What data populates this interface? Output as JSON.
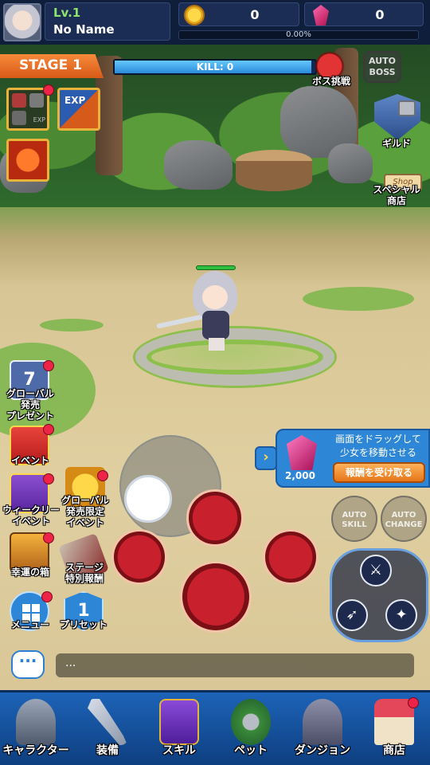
{
  "player": {
    "level": "Lv.1",
    "name": "No Name"
  },
  "currency": {
    "gold": "0",
    "gems": "0",
    "exp_percent": "0.00%"
  },
  "stage": {
    "label": "STAGE 1",
    "kill_text": "KILL: 0",
    "kill_progress": 0.0
  },
  "top_right": {
    "boss_challenge": "ボス挑戦",
    "auto_boss": "AUTO\nBOSS",
    "guild": "ギルド",
    "shop_sign": "Shop",
    "special_shop": "スペシャル\n商店"
  },
  "buffs": {
    "exp_label": "EXP",
    "stat_labels": [
      "EXP"
    ]
  },
  "left_menu": [
    {
      "id": "global-release-present",
      "label": "グローバル\n発売\nプレゼント",
      "badge": "7",
      "has_dot": true
    },
    {
      "id": "event",
      "label": "イベント",
      "has_dot": true
    },
    {
      "id": "weekly-event",
      "label": "ウィークリー\nイベント",
      "has_dot": true
    },
    {
      "id": "global-limited-event",
      "label": "グローバル\n発売限定\nイベント",
      "has_dot": true
    },
    {
      "id": "lucky-box",
      "label": "幸運の箱",
      "has_dot": true
    },
    {
      "id": "stage-special-reward",
      "label": "ステージ\n特別報酬",
      "has_dot": false
    },
    {
      "id": "menu",
      "label": "メニュー",
      "has_dot": true
    },
    {
      "id": "preset",
      "label": "プリセット",
      "badge": "1",
      "has_dot": false
    }
  ],
  "popup": {
    "text": "画面をドラッグして\n少女を移動させる",
    "button": "報酬を受け取る",
    "reward": "2,000"
  },
  "auto_buttons": {
    "skill": "AUTO\nSKILL",
    "change": "AUTO\nCHANGE"
  },
  "chat": {
    "message": "..."
  },
  "bottom_nav": [
    {
      "id": "character",
      "label": "キャラクター",
      "has_dot": false
    },
    {
      "id": "equipment",
      "label": "装備",
      "has_dot": false
    },
    {
      "id": "skill",
      "label": "スキル",
      "has_dot": false
    },
    {
      "id": "pet",
      "label": "ペット",
      "has_dot": false
    },
    {
      "id": "dungeon",
      "label": "ダンジョン",
      "has_dot": false
    },
    {
      "id": "shop",
      "label": "商店",
      "has_dot": true
    }
  ],
  "colors": {
    "accent": "#2d86d6",
    "stage": "#f0782a",
    "alert_dot": "#ee2348",
    "level_text": "#8fe36a"
  }
}
